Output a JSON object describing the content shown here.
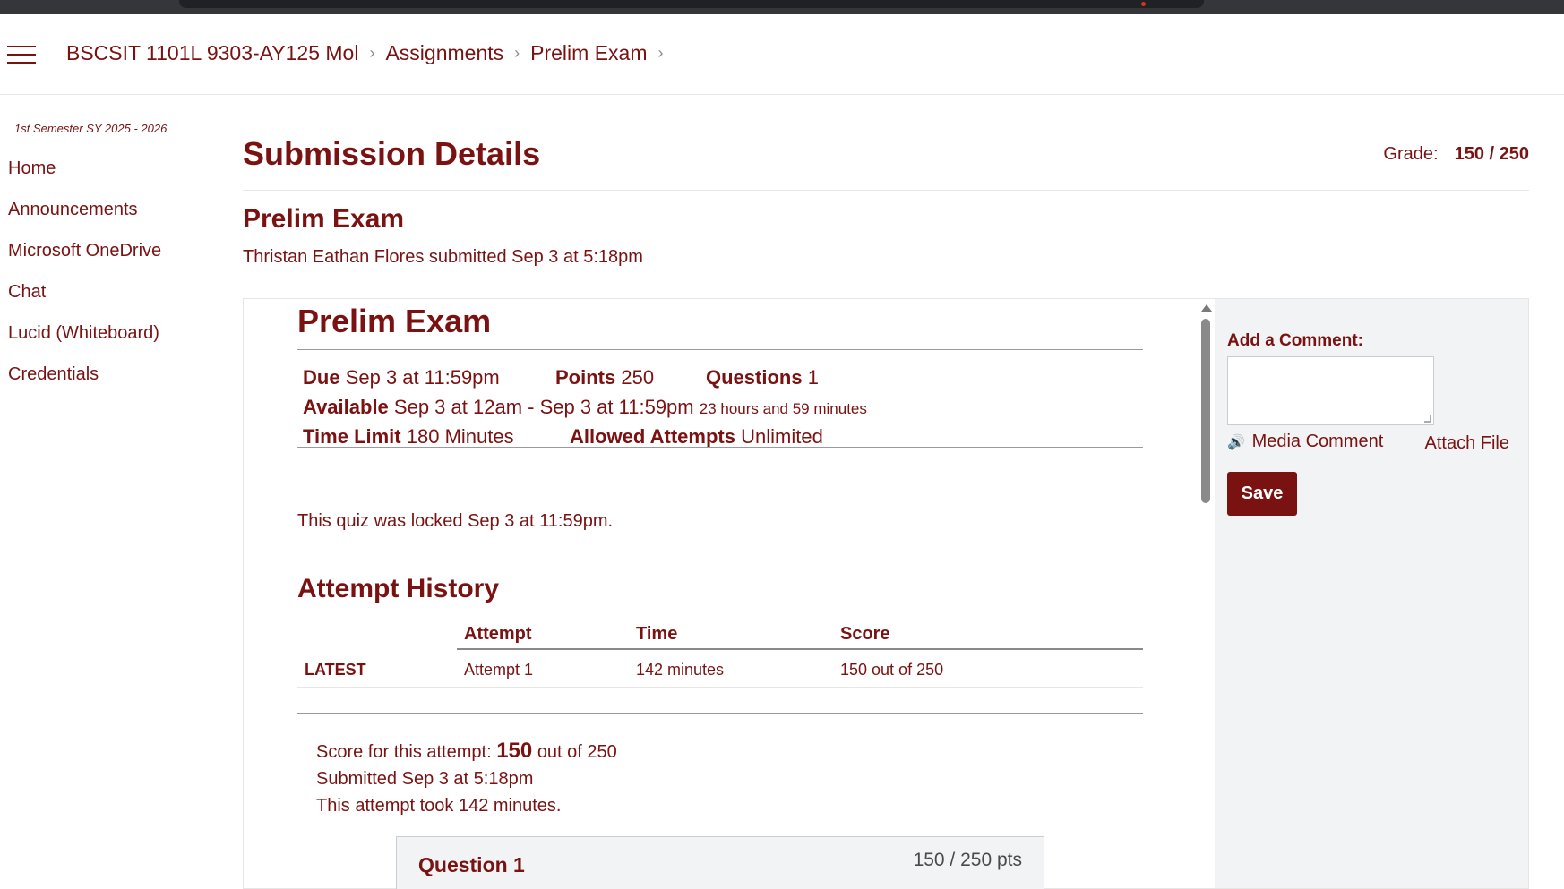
{
  "breadcrumb": {
    "items": [
      "BSCSIT 1101L 9303-AY125 Mol",
      "Assignments",
      "Prelim Exam"
    ],
    "separator": "›"
  },
  "sidebar": {
    "term": "1st Semester SY 2025 - 2026",
    "items": [
      {
        "label": "Home"
      },
      {
        "label": "Announcements"
      },
      {
        "label": "Microsoft OneDrive"
      },
      {
        "label": "Chat"
      },
      {
        "label": "Lucid (Whiteboard)"
      },
      {
        "label": "Credentials"
      }
    ]
  },
  "header": {
    "title": "Submission Details",
    "grade_label": "Grade:",
    "grade_value": "150 / 250",
    "assignment_title": "Prelim Exam",
    "submitted_by": "Thristan Eathan Flores submitted Sep 3 at 5:18pm"
  },
  "quiz": {
    "title": "Prelim Exam",
    "due_label": "Due",
    "due_value": "Sep 3 at 11:59pm",
    "points_label": "Points",
    "points_value": "250",
    "questions_label": "Questions",
    "questions_value": "1",
    "available_label": "Available",
    "available_value": "Sep 3 at 12am - Sep 3 at 11:59pm",
    "available_duration": "23 hours and 59 minutes",
    "time_limit_label": "Time Limit",
    "time_limit_value": "180 Minutes",
    "attempts_label": "Allowed Attempts",
    "attempts_value": "Unlimited",
    "locked_message": "This quiz was locked Sep 3 at 11:59pm."
  },
  "attempt_history": {
    "title": "Attempt History",
    "columns": [
      "Attempt",
      "Time",
      "Score"
    ],
    "rows": [
      {
        "tag": "LATEST",
        "attempt": "Attempt 1",
        "time": "142 minutes",
        "score": "150 out of 250"
      }
    ]
  },
  "score_summary": {
    "prefix": "Score for this attempt:",
    "score": "150",
    "suffix": "out of 250",
    "submitted": "Submitted Sep 3 at 5:18pm",
    "duration": "This attempt took 142 minutes."
  },
  "question": {
    "name": "Question 1",
    "points": "150 / 250 pts"
  },
  "comment_panel": {
    "label": "Add a Comment:",
    "media_comment": "Media Comment",
    "attach_file": "Attach File",
    "save_label": "Save"
  },
  "colors": {
    "brand": "#7a1212",
    "panel_bg": "#f2f3f4",
    "browser_bar": "#35363a"
  }
}
